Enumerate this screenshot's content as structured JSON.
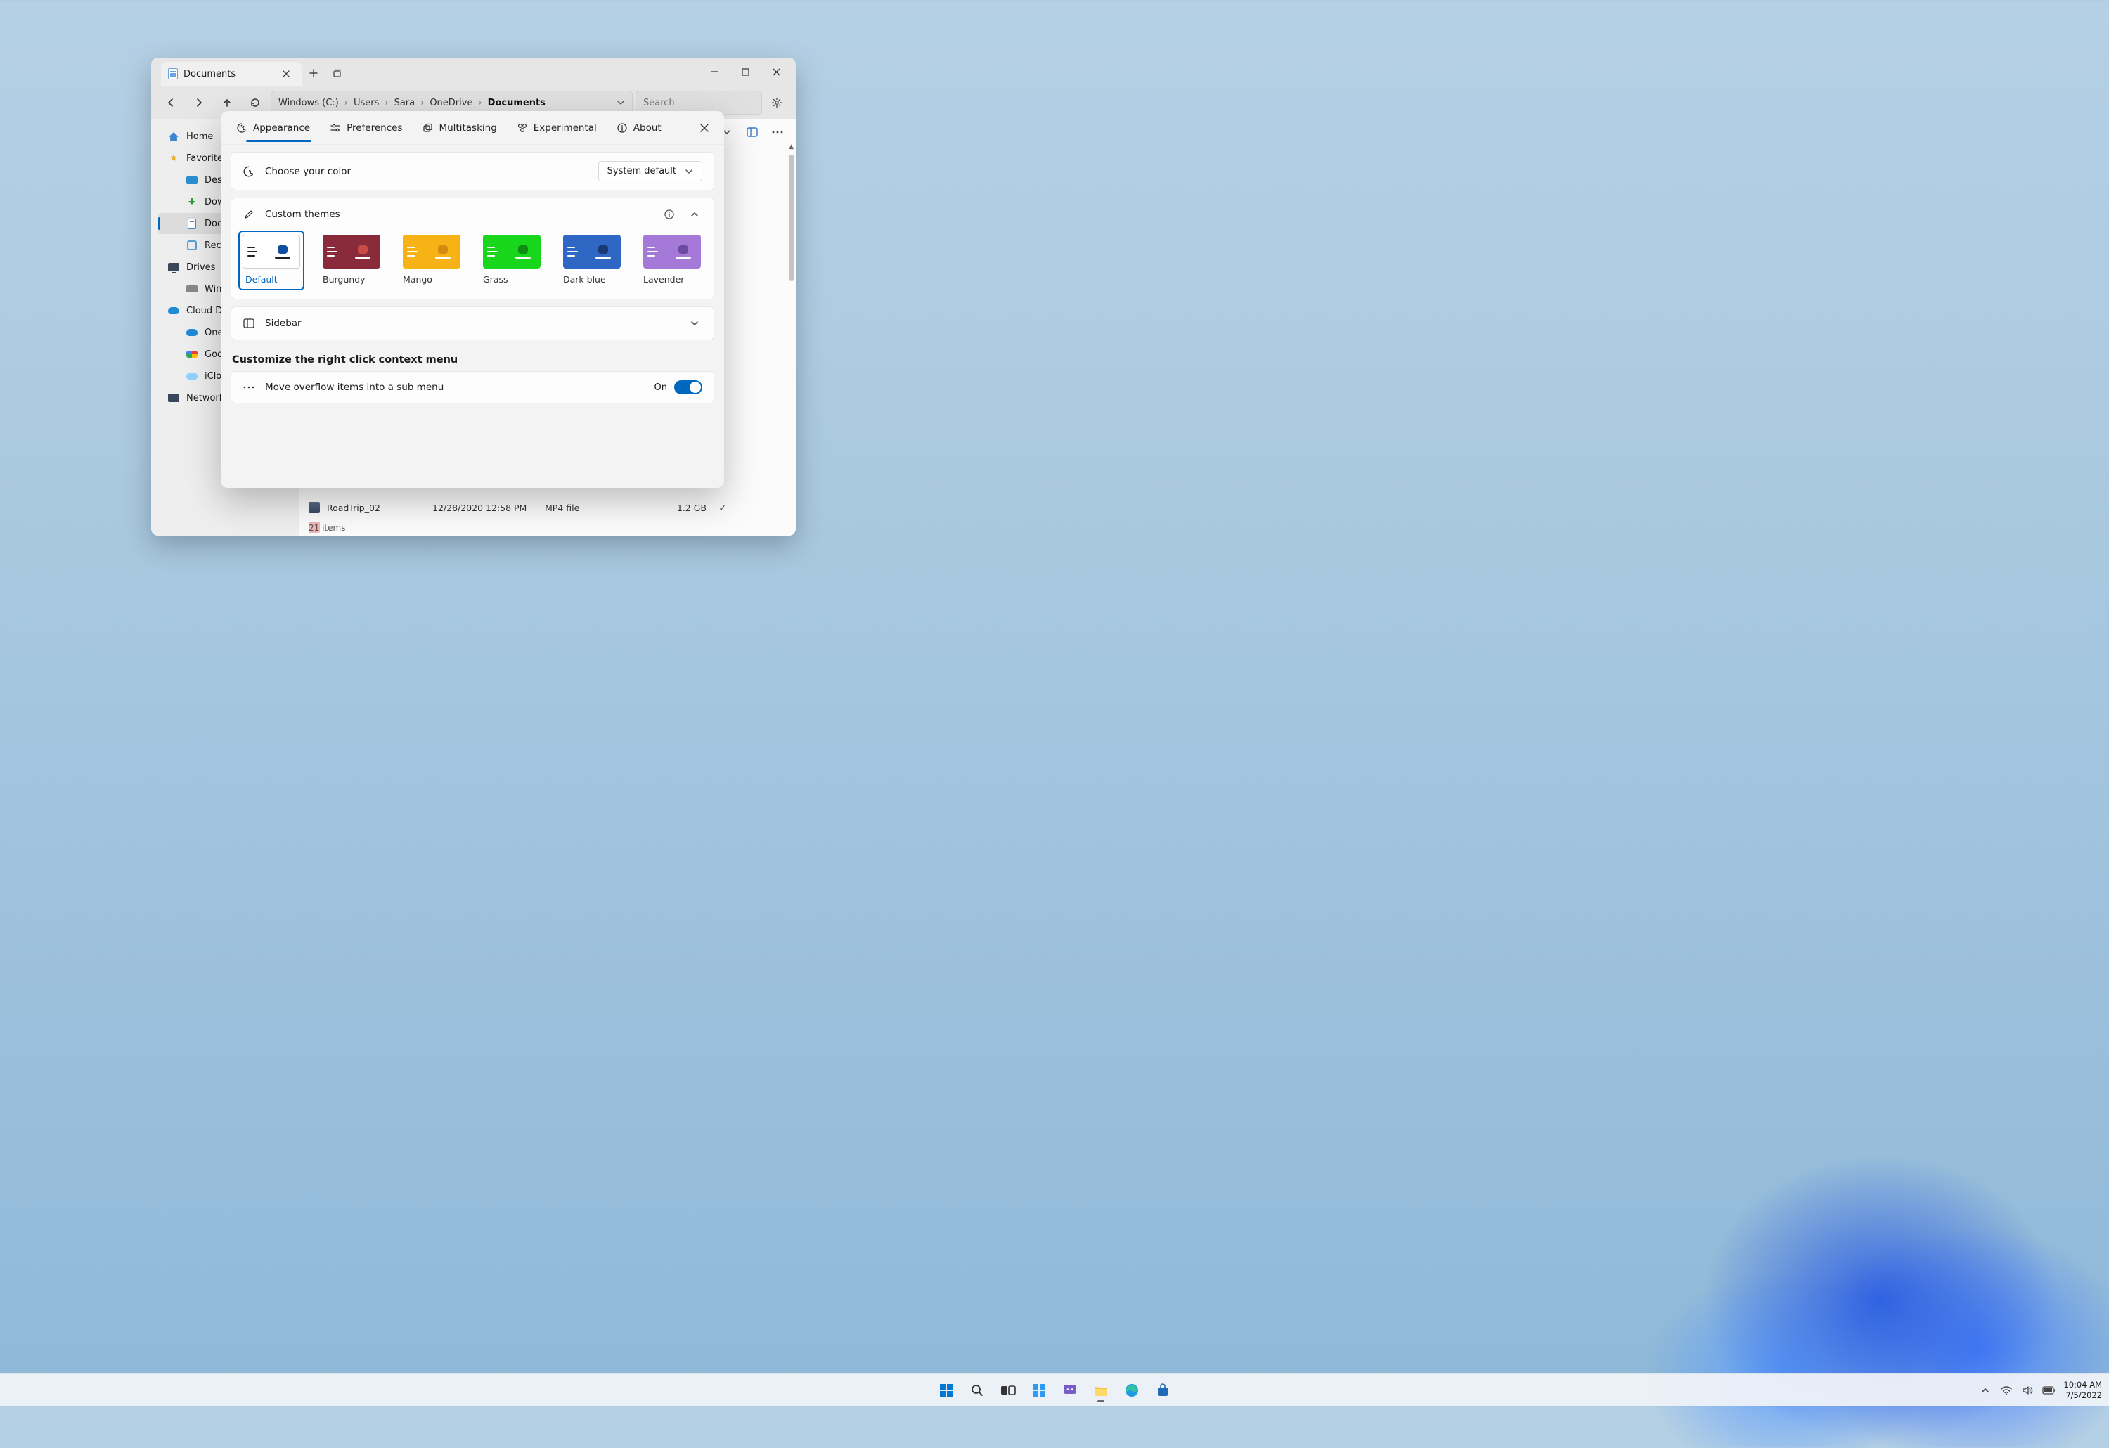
{
  "explorer": {
    "tab_title": "Documents",
    "breadcrumb": [
      "Windows (C:)",
      "Users",
      "Sara",
      "OneDrive",
      "Documents"
    ],
    "search_placeholder": "Search",
    "sidebar": {
      "home": "Home",
      "favorites": "Favorites",
      "fav_items": [
        "Deskt",
        "Down",
        "Docu",
        "Recyc"
      ],
      "drives": "Drives",
      "drive_items": [
        "Wind"
      ],
      "cloud": "Cloud Driv",
      "cloud_items": [
        "One",
        "Goog",
        "iClou"
      ],
      "network": "Network D"
    },
    "rows": [
      {
        "name": "RoadTrip_02",
        "date": "12/28/2020  12:58 PM",
        "type": "MP4 file",
        "size": "1.2 GB",
        "checked": true,
        "kind": "mp4"
      },
      {
        "name": "",
        "date": "",
        "type": "",
        "size": "",
        "checked": false,
        "kind": "pdf"
      }
    ],
    "status": "21 items"
  },
  "settings": {
    "tabs": [
      {
        "id": "appearance",
        "label": "Appearance",
        "icon": "palette-icon",
        "active": true
      },
      {
        "id": "preferences",
        "label": "Preferences",
        "icon": "sliders-icon",
        "active": false
      },
      {
        "id": "multitasking",
        "label": "Multitasking",
        "icon": "copy-icon",
        "active": false
      },
      {
        "id": "experimental",
        "label": "Experimental",
        "icon": "beaker-icon",
        "active": false
      },
      {
        "id": "about",
        "label": "About",
        "icon": "info-icon",
        "active": false
      }
    ],
    "color_section": {
      "title": "Choose your color",
      "select_value": "System default"
    },
    "themes_section": {
      "title": "Custom themes"
    },
    "themes": [
      {
        "name": "Default",
        "selected": true,
        "bg": "#ffffff",
        "left_bg": "#ffffff",
        "bars": "#222",
        "accent": "#0f4f9e",
        "line": "#222"
      },
      {
        "name": "Burgundy",
        "selected": false,
        "bg": "#8a2b3b",
        "left_bg": "#8a2b3b",
        "bars": "#fff",
        "accent": "#c94b44",
        "line": "#fff"
      },
      {
        "name": "Mango",
        "selected": false,
        "bg": "#f7b316",
        "left_bg": "#f7b316",
        "bars": "#fff",
        "accent": "#d78a11",
        "line": "#fff"
      },
      {
        "name": "Grass",
        "selected": false,
        "bg": "#18d61c",
        "left_bg": "#18d61c",
        "bars": "#fff",
        "accent": "#0e8f12",
        "line": "#fff"
      },
      {
        "name": "Dark blue",
        "selected": false,
        "bg": "#2e68c4",
        "left_bg": "#2e68c4",
        "bars": "#fff",
        "accent": "#173a74",
        "line": "#fff"
      },
      {
        "name": "Lavender",
        "selected": false,
        "bg": "#a579d8",
        "left_bg": "#a579d8",
        "bars": "#fff",
        "accent": "#6b4aa0",
        "line": "#fff"
      }
    ],
    "sidebar_section": {
      "title": "Sidebar"
    },
    "context_section": {
      "heading": "Customize the right click context menu",
      "toggle_label": "Move overflow items into a sub menu",
      "toggle_value": "On"
    }
  },
  "taskbar": {
    "time": "10:04 AM",
    "date": "7/5/2022"
  }
}
